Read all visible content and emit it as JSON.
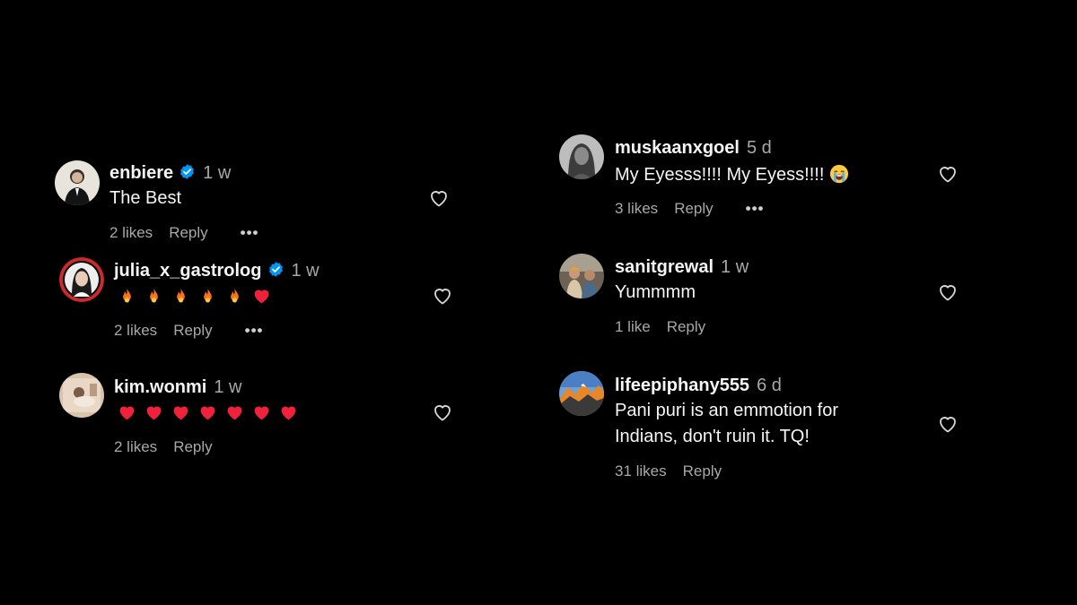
{
  "left": [
    {
      "username": "enbiere",
      "verified": true,
      "time": "1 w",
      "text": "The Best",
      "likes": "2 likes",
      "reply": "Reply",
      "more": "•••"
    },
    {
      "username": "julia_x_gastrolog",
      "verified": true,
      "time": "1 w",
      "emojis": [
        "fire",
        "fire",
        "fire",
        "fire",
        "fire",
        "red-heart"
      ],
      "likes": "2 likes",
      "reply": "Reply",
      "more": "•••"
    },
    {
      "username": "kim.wonmi",
      "verified": false,
      "time": "1 w",
      "emojis": [
        "red-heart",
        "red-heart",
        "red-heart",
        "red-heart",
        "red-heart",
        "red-heart",
        "red-heart"
      ],
      "likes": "2 likes",
      "reply": "Reply"
    }
  ],
  "right": [
    {
      "username": "muskaanxgoel",
      "time": "5 d",
      "text": "My Eyesss!!!! My Eyess!!!!",
      "text_emoji": "loudly-crying-face",
      "likes": "3 likes",
      "reply": "Reply",
      "more": "•••"
    },
    {
      "username": "sanitgrewal",
      "time": "1 w",
      "text": "Yummmm",
      "likes": "1 like",
      "reply": "Reply"
    },
    {
      "username": "lifeepiphany555",
      "time": "6 d",
      "text_lines": [
        "Pani puri is an emmotion for",
        "Indians, don't ruin it. TQ!"
      ],
      "likes": "31 likes",
      "reply": "Reply"
    }
  ],
  "colors": {
    "background": "#000000",
    "text": "#f5f5f5",
    "secondary": "#a8a8a8",
    "verified": "#0095f6",
    "story_ring": "#c92a2a"
  }
}
